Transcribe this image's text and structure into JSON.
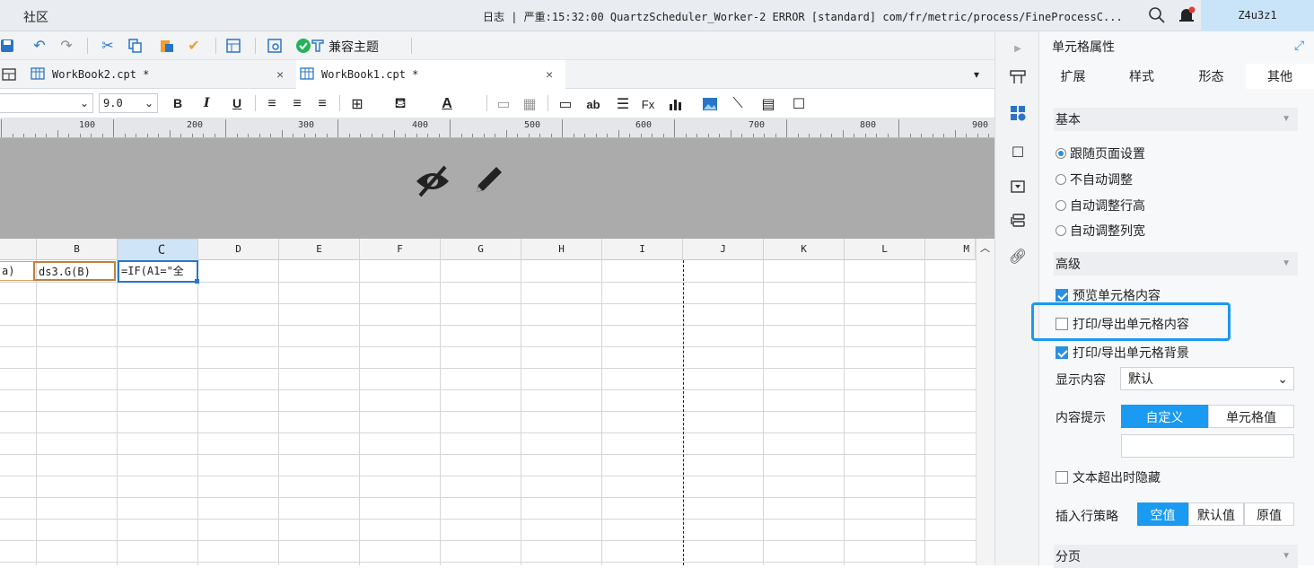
{
  "topbar": {
    "title": "社区",
    "log": "日志 | 严重:15:32:00 QuartzScheduler_Worker-2 ERROR [standard] com/fr/metric/process/FineProcessC...",
    "user": "Z4u3z1"
  },
  "toolbar": {
    "compat_label": "兼容主题",
    "icons": [
      "save-icon",
      "undo-icon",
      "redo-icon",
      "cut-icon",
      "copy-icon",
      "paste-icon",
      "format-brush-icon",
      "template-icon",
      "preview-icon",
      "check-icon",
      "theme-icon"
    ]
  },
  "tabs": [
    {
      "label": "WorkBook2.cpt *",
      "active": false
    },
    {
      "label": "WorkBook1.cpt *",
      "active": true
    }
  ],
  "font_toolbar": {
    "font_size": "9.0",
    "bold": "B",
    "italic": "I",
    "underline": "U"
  },
  "ruler": {
    "labels": [
      "100",
      "200",
      "300",
      "400",
      "500",
      "600",
      "700",
      "800",
      "900"
    ]
  },
  "grid": {
    "columns": [
      "B",
      "C",
      "D",
      "E",
      "F",
      "G",
      "H",
      "I",
      "J",
      "K",
      "L",
      "M"
    ],
    "selected_column": "C",
    "cells": {
      "a1": "a)",
      "b1": "ds3.G(B)",
      "c1": "=IF(A1=\"全"
    }
  },
  "panel": {
    "title": "单元格属性",
    "tabs": [
      "扩展",
      "样式",
      "形态",
      "其他"
    ],
    "active_tab": "其他",
    "basic": {
      "header": "基本",
      "options": [
        "跟随页面设置",
        "不自动调整",
        "自动调整行高",
        "自动调整列宽"
      ],
      "selected": "跟随页面设置"
    },
    "advanced": {
      "header": "高级",
      "preview": {
        "label": "预览单元格内容",
        "checked": true
      },
      "print_content": {
        "label": "打印/导出单元格内容",
        "checked": false
      },
      "print_bg": {
        "label": "打印/导出单元格背景",
        "checked": true
      },
      "display_label": "显示内容",
      "display_value": "默认",
      "tip_label": "内容提示",
      "tip_options": [
        "自定义",
        "单元格值"
      ],
      "tip_selected": "自定义",
      "tip_input": "",
      "hide_overflow": {
        "label": "文本超出时隐藏",
        "checked": false
      },
      "insert_label": "插入行策略",
      "insert_options": [
        "空值",
        "默认值",
        "原值"
      ],
      "insert_selected": "空值"
    },
    "paging": {
      "header": "分页"
    }
  },
  "colors": {
    "accent": "#1a9af0",
    "selected_col": "#cfe5f7",
    "band": "#ababab"
  }
}
